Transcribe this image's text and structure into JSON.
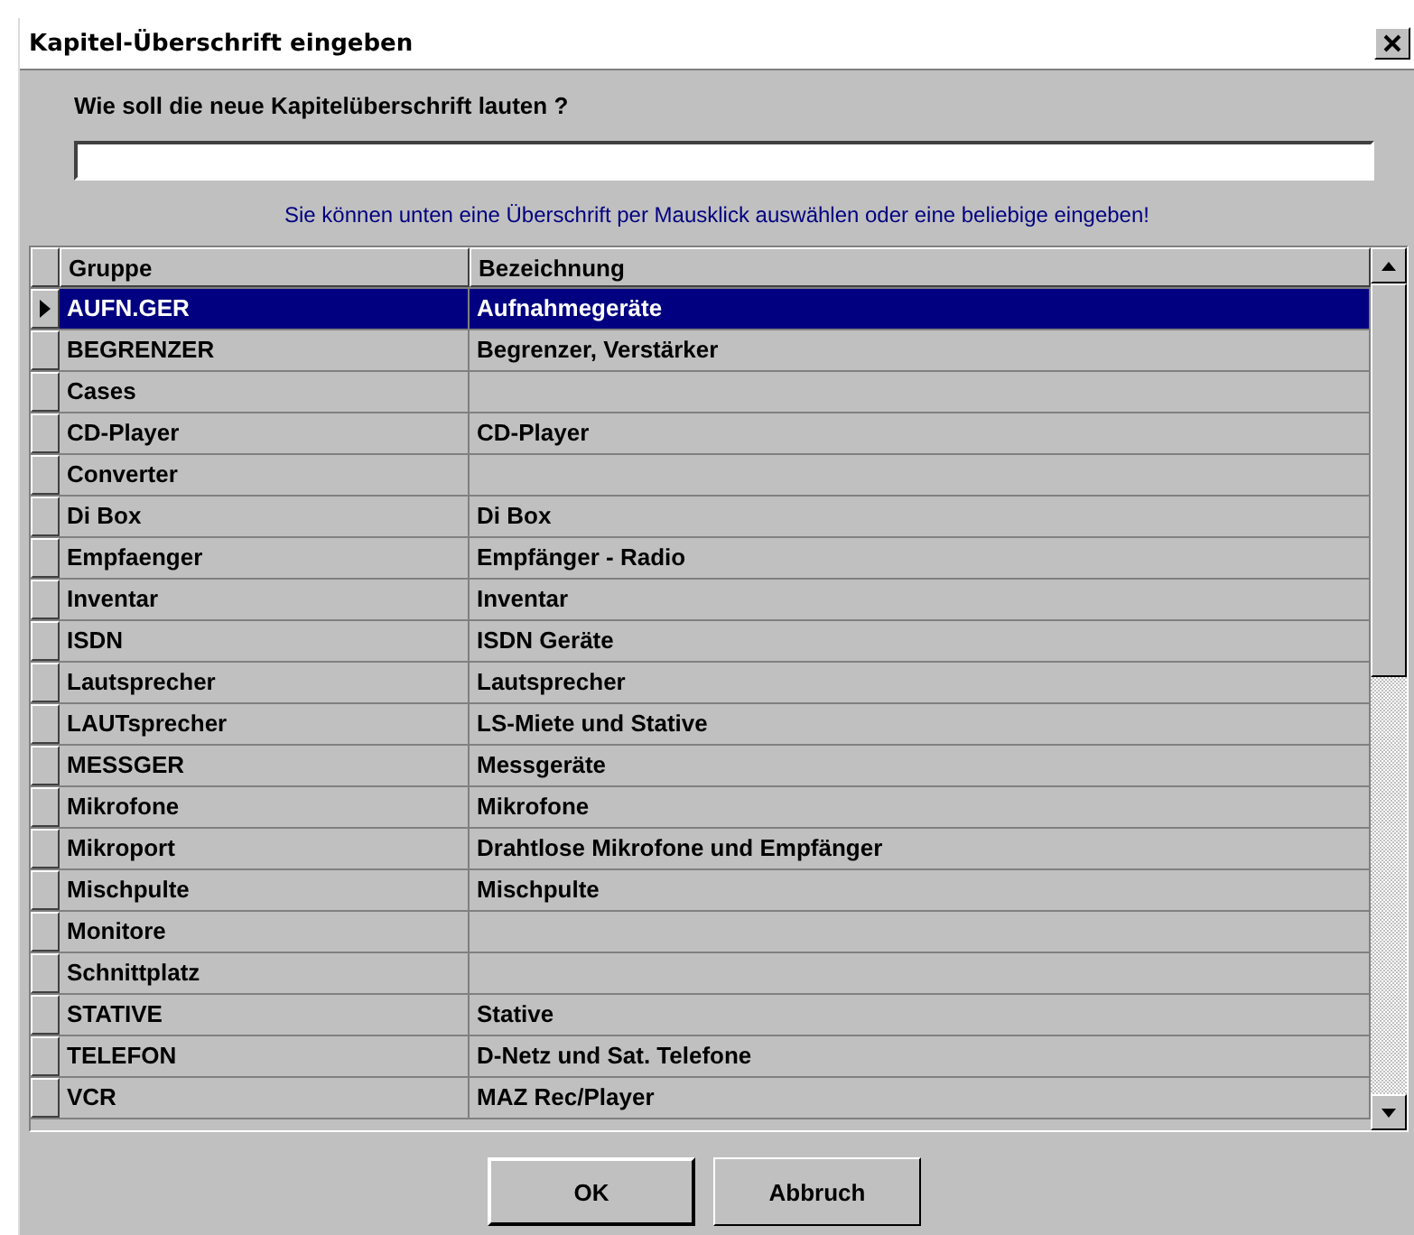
{
  "window": {
    "title": "Kapitel-Überschrift eingeben"
  },
  "prompt": "Wie soll die neue Kapitelüberschrift lauten ?",
  "hint": "Sie können unten eine Überschrift per Mausklick auswählen oder eine beliebige eingeben!",
  "table": {
    "columns": [
      "Gruppe",
      "Bezeichnung"
    ],
    "rows": [
      {
        "cells": [
          "AUFN.GER",
          "Aufnahmegeräte"
        ],
        "selected": true
      },
      {
        "cells": [
          "BEGRENZER",
          "Begrenzer, Verstärker"
        ],
        "selected": false
      },
      {
        "cells": [
          "Cases",
          ""
        ],
        "selected": false
      },
      {
        "cells": [
          "CD-Player",
          "CD-Player"
        ],
        "selected": false
      },
      {
        "cells": [
          "Converter",
          ""
        ],
        "selected": false
      },
      {
        "cells": [
          "Di Box",
          "Di Box"
        ],
        "selected": false
      },
      {
        "cells": [
          "Empfaenger",
          "Empfänger - Radio"
        ],
        "selected": false
      },
      {
        "cells": [
          "Inventar",
          "Inventar"
        ],
        "selected": false
      },
      {
        "cells": [
          "ISDN",
          "ISDN Geräte"
        ],
        "selected": false
      },
      {
        "cells": [
          "Lautsprecher",
          "Lautsprecher"
        ],
        "selected": false
      },
      {
        "cells": [
          "LAUTsprecher",
          "LS-Miete und Stative"
        ],
        "selected": false
      },
      {
        "cells": [
          "MESSGER",
          "Messgeräte"
        ],
        "selected": false
      },
      {
        "cells": [
          "Mikrofone",
          "Mikrofone"
        ],
        "selected": false
      },
      {
        "cells": [
          "Mikroport",
          "Drahtlose Mikrofone und Empfänger"
        ],
        "selected": false
      },
      {
        "cells": [
          "Mischpulte",
          "Mischpulte"
        ],
        "selected": false
      },
      {
        "cells": [
          "Monitore",
          ""
        ],
        "selected": false
      },
      {
        "cells": [
          "Schnittplatz",
          ""
        ],
        "selected": false
      },
      {
        "cells": [
          "STATIVE",
          "Stative"
        ],
        "selected": false
      },
      {
        "cells": [
          "TELEFON",
          "D-Netz und Sat. Telefone"
        ],
        "selected": false
      },
      {
        "cells": [
          "VCR",
          "MAZ Rec/Player"
        ],
        "selected": false
      }
    ]
  },
  "buttons": [
    {
      "label": "OK",
      "default": true
    },
    {
      "label": "Abbruch",
      "default": false
    }
  ]
}
